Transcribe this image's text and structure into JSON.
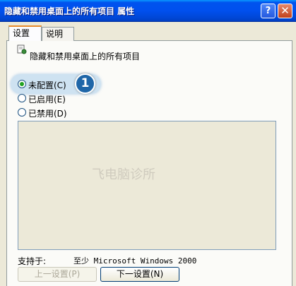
{
  "window": {
    "title": "隐藏和禁用桌面上的所有项目 属性"
  },
  "titlebar": {
    "help_glyph": "?",
    "close_glyph": "✕"
  },
  "tabs": [
    {
      "label": "设置"
    },
    {
      "label": "说明"
    }
  ],
  "policy": {
    "title": "隐藏和禁用桌面上的所有项目",
    "icon": "policy-setting-icon"
  },
  "options": [
    {
      "label": "未配置(C)",
      "checked": true
    },
    {
      "label": "已启用(E)",
      "checked": false
    },
    {
      "label": "已禁用(D)",
      "checked": false
    }
  ],
  "annotation": {
    "step": "1"
  },
  "watermark": "飞电脑诊所",
  "supported": {
    "label": "支持于:",
    "value": "至少 Microsoft Windows 2000"
  },
  "buttons": {
    "prev": "上一设置(P)",
    "next": "下一设置(N)"
  },
  "colors": {
    "titlebar": "#0053ee",
    "face": "#ece9d8",
    "accent_tab": "#e68b2c"
  }
}
